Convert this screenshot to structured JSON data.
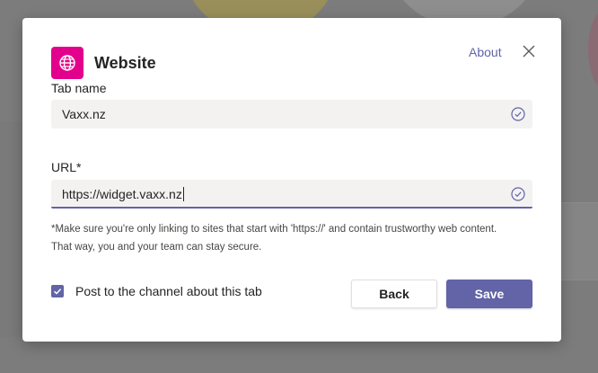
{
  "dialog": {
    "title": "Website",
    "app_icon": "globe-icon",
    "about_label": "About",
    "close_icon": "close-icon"
  },
  "fields": {
    "tab_name": {
      "label": "Tab name",
      "value": "Vaxx.nz",
      "status_icon": "check-circle-icon"
    },
    "url": {
      "label": "URL*",
      "value": "https://widget.vaxx.nz",
      "status_icon": "check-circle-icon"
    }
  },
  "note": {
    "line1": "*Make sure you're only linking to sites that start with 'https://' and contain trustworthy web content.",
    "line2": "That way, you and your team can stay secure."
  },
  "footer": {
    "checkbox_checked": true,
    "checkbox_label": "Post to the channel about this tab",
    "back_label": "Back",
    "save_label": "Save"
  },
  "colors": {
    "accent": "#6264a7",
    "app_icon_bg": "#e3008c",
    "overlay": "#7c7c7c"
  }
}
